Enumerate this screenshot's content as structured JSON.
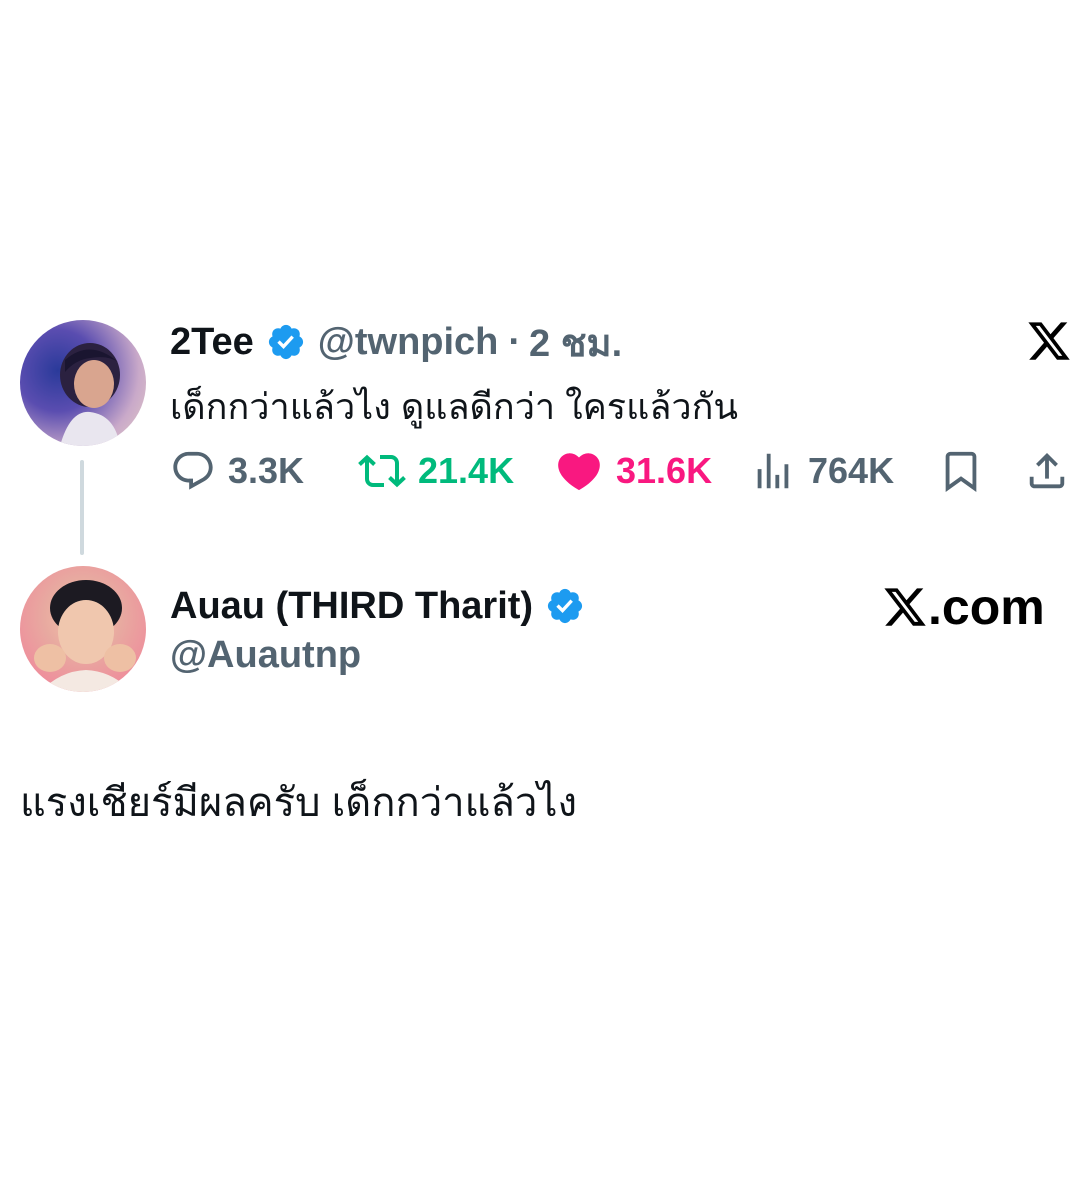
{
  "parent_tweet": {
    "display_name": "2Tee",
    "handle": "@twnpich",
    "separator": "·",
    "time": "2 ชม.",
    "text": "เด็กกว่าแล้วไง ดูแลดีกว่า ใครแล้วกัน",
    "stats": {
      "replies": "3.3K",
      "retweets": "21.4K",
      "likes": "31.6K",
      "views": "764K"
    }
  },
  "reply_tweet": {
    "display_name": "Auau (THIRD Tharit)",
    "handle": "@Auautnp",
    "text": "แรงเชียร์มีผลครับ เด็กกว่าแล้วไง"
  },
  "branding": {
    "site_suffix": ".com"
  },
  "colors": {
    "text": "#0f1419",
    "muted": "#536471",
    "verified": "#1d9bf0",
    "retweet": "#00ba7c",
    "like": "#f91880"
  },
  "icons": [
    "verified-badge-icon",
    "x-logo-icon",
    "reply-icon",
    "retweet-icon",
    "heart-icon",
    "views-icon",
    "bookmark-icon",
    "share-icon"
  ]
}
